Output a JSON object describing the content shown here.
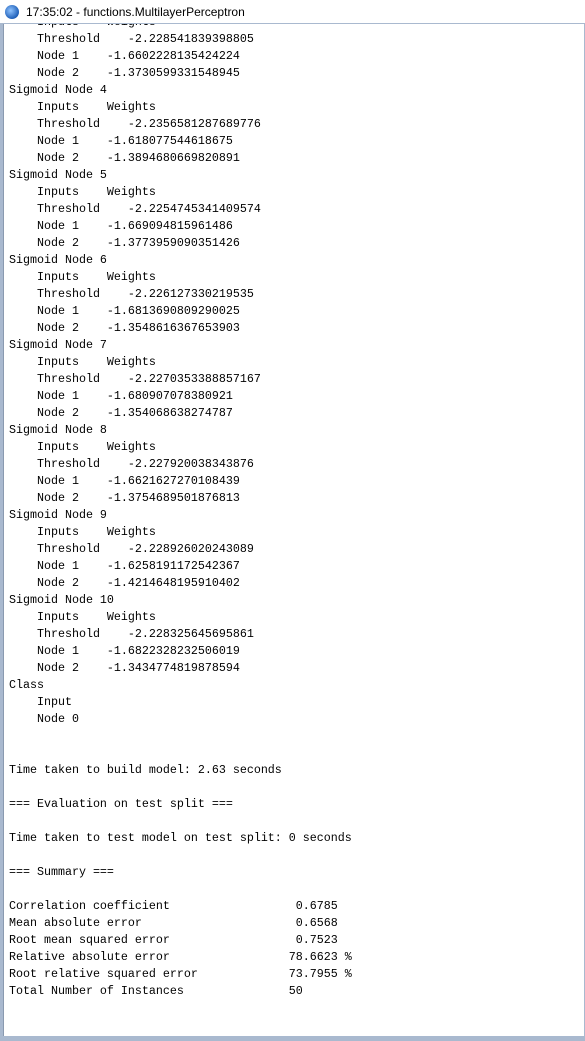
{
  "window": {
    "title": "17:35:02 - functions.MultilayerPerceptron"
  },
  "output_lines": [
    "    Inputs    Weights",
    "    Threshold    -2.228541839398805",
    "    Node 1    -1.6602228135424224",
    "    Node 2    -1.3730599331548945",
    "Sigmoid Node 4",
    "    Inputs    Weights",
    "    Threshold    -2.2356581287689776",
    "    Node 1    -1.618077544618675",
    "    Node 2    -1.3894680669820891",
    "Sigmoid Node 5",
    "    Inputs    Weights",
    "    Threshold    -2.2254745341409574",
    "    Node 1    -1.669094815961486",
    "    Node 2    -1.3773959090351426",
    "Sigmoid Node 6",
    "    Inputs    Weights",
    "    Threshold    -2.226127330219535",
    "    Node 1    -1.6813690809290025",
    "    Node 2    -1.3548616367653903",
    "Sigmoid Node 7",
    "    Inputs    Weights",
    "    Threshold    -2.2270353388857167",
    "    Node 1    -1.680907078380921",
    "    Node 2    -1.354068638274787",
    "Sigmoid Node 8",
    "    Inputs    Weights",
    "    Threshold    -2.227920038343876",
    "    Node 1    -1.6621627270108439",
    "    Node 2    -1.3754689501876813",
    "Sigmoid Node 9",
    "    Inputs    Weights",
    "    Threshold    -2.228926020243089",
    "    Node 1    -1.6258191172542367",
    "    Node 2    -1.4214648195910402",
    "Sigmoid Node 10",
    "    Inputs    Weights",
    "    Threshold    -2.228325645695861",
    "    Node 1    -1.6822328232506019",
    "    Node 2    -1.3434774819878594",
    "Class",
    "    Input",
    "    Node 0",
    "",
    "",
    "Time taken to build model: 2.63 seconds",
    "",
    "=== Evaluation on test split ===",
    "",
    "Time taken to test model on test split: 0 seconds",
    "",
    "=== Summary ===",
    "",
    "Correlation coefficient                  0.6785",
    "Mean absolute error                      0.6568",
    "Root mean squared error                  0.7523",
    "Relative absolute error                 78.6623 %",
    "Root relative squared error             73.7955 %",
    "Total Number of Instances               50     "
  ]
}
